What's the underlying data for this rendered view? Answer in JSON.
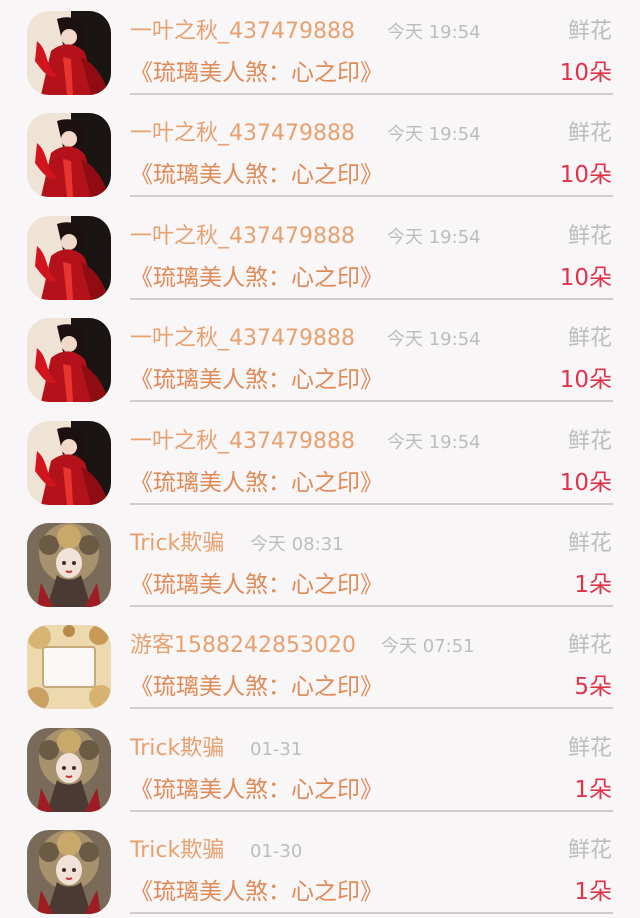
{
  "colors": {
    "name": "#e8a06e",
    "time": "#bdbdbd",
    "gift": "#bdbdbd",
    "book": "#e08a57",
    "count": "#e0334a",
    "background": "#f8f6f7"
  },
  "items": [
    {
      "avatar": "avatar-red-woman",
      "name": "一叶之秋_437479888",
      "time": "今天 19:54",
      "gift": "鲜花",
      "book": "《琉璃美人煞：心之印》",
      "count": "10朵"
    },
    {
      "avatar": "avatar-red-woman",
      "name": "一叶之秋_437479888",
      "time": "今天 19:54",
      "gift": "鲜花",
      "book": "《琉璃美人煞：心之印》",
      "count": "10朵"
    },
    {
      "avatar": "avatar-red-woman",
      "name": "一叶之秋_437479888",
      "time": "今天 19:54",
      "gift": "鲜花",
      "book": "《琉璃美人煞：心之印》",
      "count": "10朵"
    },
    {
      "avatar": "avatar-red-woman",
      "name": "一叶之秋_437479888",
      "time": "今天 19:54",
      "gift": "鲜花",
      "book": "《琉璃美人煞：心之印》",
      "count": "10朵"
    },
    {
      "avatar": "avatar-red-woman",
      "name": "一叶之秋_437479888",
      "time": "今天 19:54",
      "gift": "鲜花",
      "book": "《琉璃美人煞：心之印》",
      "count": "10朵"
    },
    {
      "avatar": "avatar-ornate-woman",
      "name": "Trick欺骗",
      "time": "今天 08:31",
      "gift": "鲜花",
      "book": "《琉璃美人煞：心之印》",
      "count": "1朵"
    },
    {
      "avatar": "avatar-floral-frame",
      "name": "游客1588242853020",
      "time": "今天 07:51",
      "gift": "鲜花",
      "book": "《琉璃美人煞：心之印》",
      "count": "5朵"
    },
    {
      "avatar": "avatar-ornate-woman",
      "name": "Trick欺骗",
      "time": "01-31",
      "gift": "鲜花",
      "book": "《琉璃美人煞：心之印》",
      "count": "1朵"
    },
    {
      "avatar": "avatar-ornate-woman",
      "name": "Trick欺骗",
      "time": "01-30",
      "gift": "鲜花",
      "book": "《琉璃美人煞：心之印》",
      "count": "1朵"
    }
  ]
}
